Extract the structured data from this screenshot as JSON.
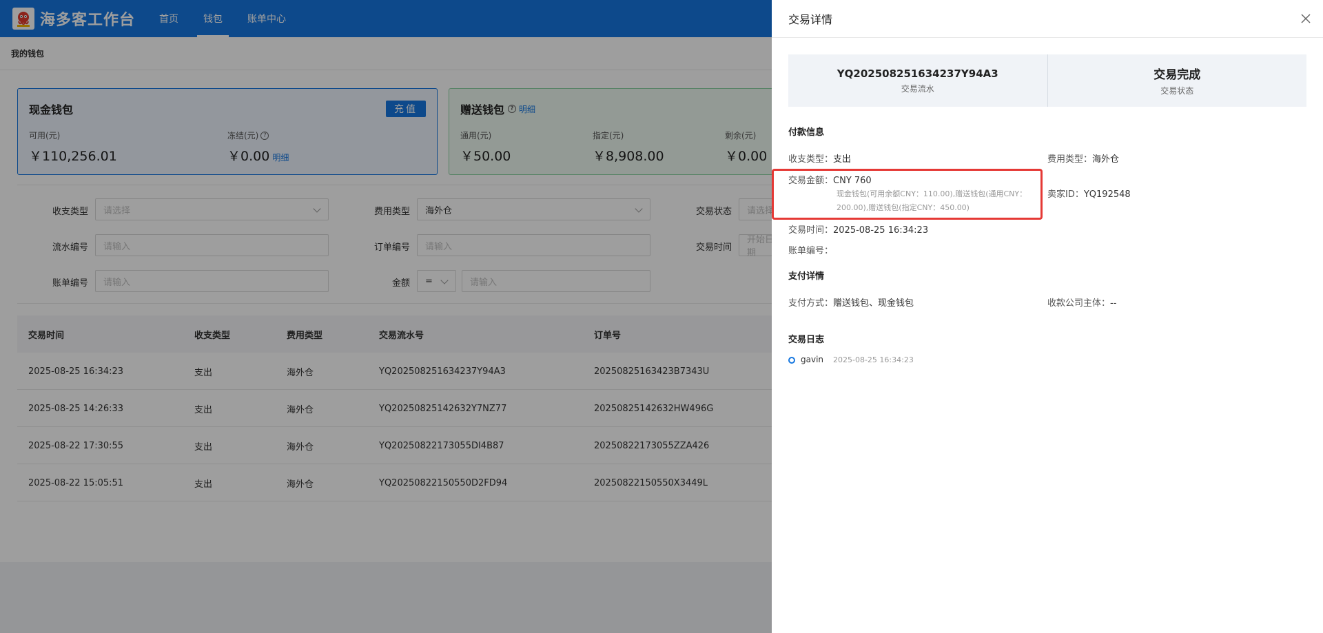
{
  "app": {
    "logo_text": "海多客工作台",
    "nav": [
      {
        "label": "首页",
        "active": false
      },
      {
        "label": "钱包",
        "active": true
      },
      {
        "label": "账单中心",
        "active": false
      }
    ]
  },
  "breadcrumb": "我的钱包",
  "cash_wallet": {
    "title": "现金钱包",
    "recharge_label": "充值",
    "available_label": "可用(元)",
    "available_value": "￥110,256.01",
    "frozen_label": "冻结(元)",
    "frozen_value": "￥0.00",
    "detail_link": "明细"
  },
  "gift_wallet": {
    "title": "赠送钱包",
    "detail_link": "明细",
    "general_label": "通用(元)",
    "general_value": "￥50.00",
    "designated_label": "指定(元)",
    "designated_value": "￥8,908.00",
    "remaining_label": "剩余(元)",
    "remaining_value": "￥0.00"
  },
  "filters": {
    "type_label": "收支类型",
    "type_placeholder": "请选择",
    "fee_label": "费用类型",
    "fee_value": "海外仓",
    "status_label": "交易状态",
    "status_placeholder": "请选择",
    "serial_label": "流水编号",
    "serial_placeholder": "请输入",
    "order_label": "订单编号",
    "order_placeholder": "请输入",
    "time_label": "交易时间",
    "time_placeholder": "开始日期",
    "bill_label": "账单编号",
    "bill_placeholder": "请输入",
    "amount_label": "金额",
    "amount_op": "=",
    "amount_placeholder": "请输入"
  },
  "table": {
    "headers": [
      "交易时间",
      "收支类型",
      "费用类型",
      "交易流水号",
      "订单号"
    ],
    "rows": [
      [
        "2025-08-25 16:34:23",
        "支出",
        "海外仓",
        "YQ202508251634237Y94A3",
        "20250825163423B7343U"
      ],
      [
        "2025-08-25 14:26:33",
        "支出",
        "海外仓",
        "YQ20250825142632Y7NZ77",
        "20250825142632HW496G"
      ],
      [
        "2025-08-22 17:30:55",
        "支出",
        "海外仓",
        "YQ20250822173055DI4B87",
        "20250822173055ZZA426"
      ],
      [
        "2025-08-22 15:05:51",
        "支出",
        "海外仓",
        "YQ20250822150550D2FD94",
        "20250822150550X3449L"
      ]
    ]
  },
  "drawer": {
    "title": "交易详情",
    "serial_no": "YQ202508251634237Y94A3",
    "serial_label": "交易流水",
    "state": "交易完成",
    "state_label": "交易状态",
    "payment_info_title": "付款信息",
    "type_key": "收支类型：",
    "type_val": "支出",
    "fee_key": "费用类型：",
    "fee_val": "海外仓",
    "amount_key": "交易金额：",
    "amount_val": "CNY 760",
    "amount_note": "现金钱包(可用余额CNY：110.00),赠送钱包(通用CNY：200.00),赠送钱包(指定CNY：450.00)",
    "seller_key": "卖家ID：",
    "seller_val": "YQ192548",
    "time_key": "交易时间：",
    "time_val": "2025-08-25 16:34:23",
    "bill_key": "账单编号：",
    "bill_val": "",
    "pay_detail_title": "支付详情",
    "method_key": "支付方式：",
    "method_val": "赠送钱包、现金钱包",
    "company_key": "收款公司主体：",
    "company_val": "--",
    "log_title": "交易日志",
    "log_user": "gavin",
    "log_time": "2025-08-25 16:34:23"
  },
  "colors": {
    "primary": "#1677e0",
    "highlight": "#e53935"
  }
}
